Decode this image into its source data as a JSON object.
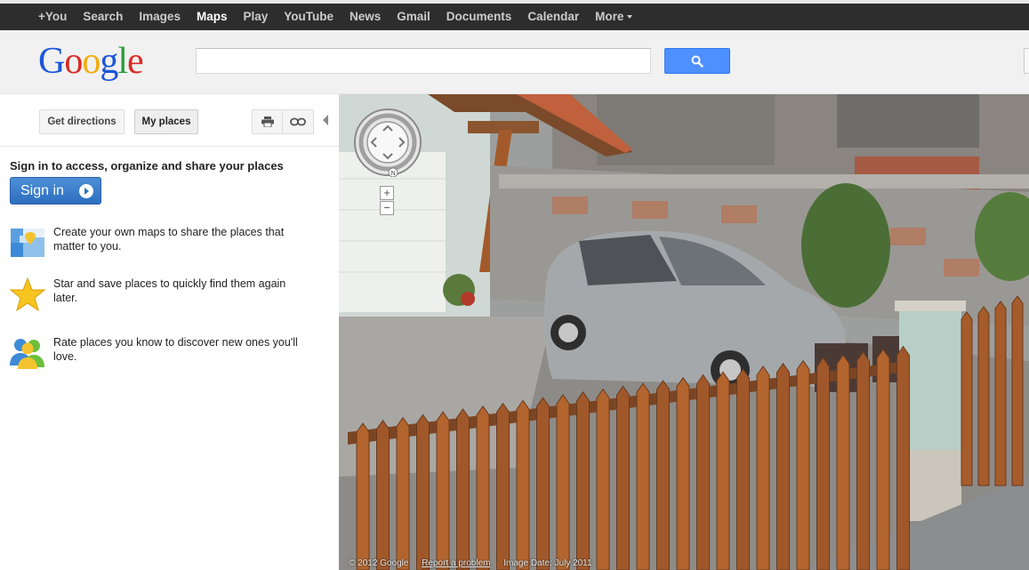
{
  "topbar": {
    "items": [
      {
        "label": "+You"
      },
      {
        "label": "Search"
      },
      {
        "label": "Images"
      },
      {
        "label": "Maps",
        "active": true
      },
      {
        "label": "Play"
      },
      {
        "label": "YouTube"
      },
      {
        "label": "News"
      },
      {
        "label": "Gmail"
      },
      {
        "label": "Documents"
      },
      {
        "label": "Calendar"
      },
      {
        "label": "More"
      }
    ]
  },
  "header": {
    "logo": {
      "g1": "G",
      "o1": "o",
      "o2": "o",
      "g2": "g",
      "l": "l",
      "e": "e"
    },
    "search": {
      "value": "",
      "placeholder": ""
    },
    "search_button_icon": "magnifier-icon"
  },
  "panel": {
    "get_directions": "Get directions",
    "my_places": "My places",
    "print_icon": "print-icon",
    "link_icon": "link-icon",
    "signin_title": "Sign in to access, organize and share your places",
    "signin_button": "Sign in",
    "features": [
      {
        "icon": "map-puzzle-icon",
        "text": "Create your own maps to share the places that matter to you."
      },
      {
        "icon": "star-icon",
        "text": "Star and save places to quickly find them again later."
      },
      {
        "icon": "people-icon",
        "text": "Rate places you know to discover new ones you'll love."
      }
    ]
  },
  "streetview": {
    "compass_label": "N",
    "zoom_in": "+",
    "zoom_out": "−",
    "copyright": "© 2012 Google",
    "report": "Report a problem",
    "image_date": "Image Date: July 2011"
  },
  "colors": {
    "topbar_bg": "#2d2d2d",
    "search_button": "#4d90fe",
    "signin_button": "#3a7bcc"
  }
}
